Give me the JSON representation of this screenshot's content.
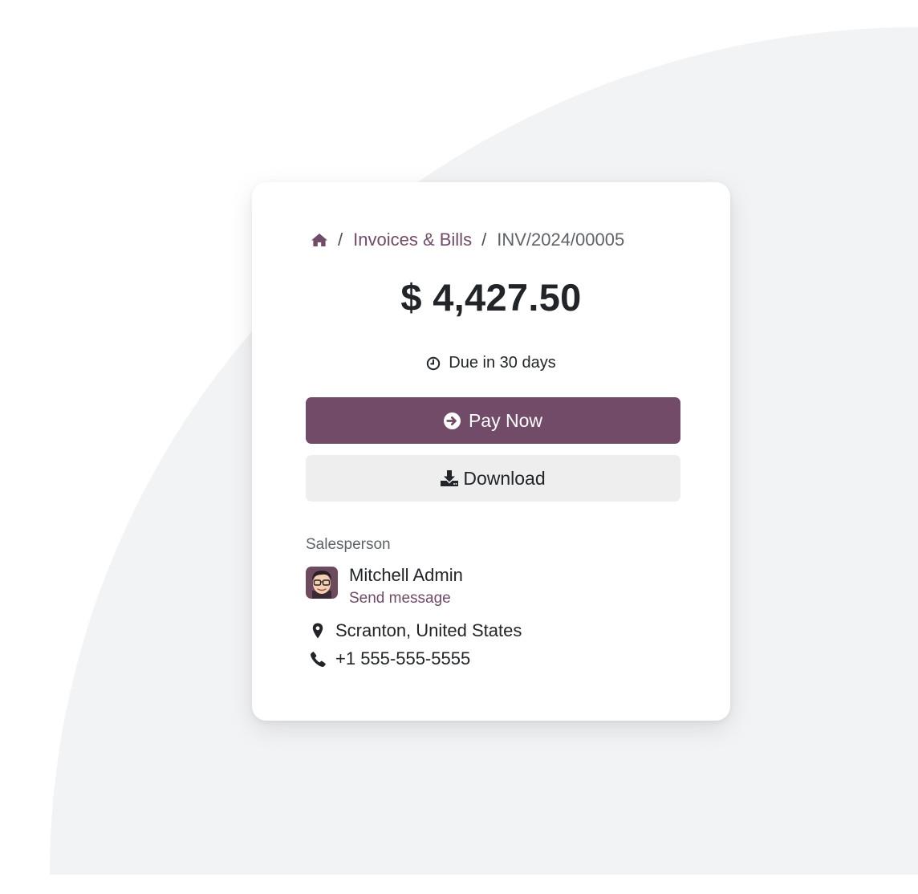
{
  "breadcrumb": {
    "home_icon": "home-icon",
    "separator": "/",
    "parent": "Invoices & Bills",
    "current": "INV/2024/00005"
  },
  "invoice": {
    "amount": "$ 4,427.50",
    "due_icon": "clock-icon",
    "due_text": "Due in 30 days"
  },
  "actions": {
    "pay_icon": "arrow-circle-right-icon",
    "pay_label": "Pay Now",
    "download_icon": "download-icon",
    "download_label": "Download"
  },
  "salesperson": {
    "section_label": "Salesperson",
    "name": "Mitchell Admin",
    "send_message": "Send message",
    "location_icon": "map-marker-icon",
    "location": "Scranton, United States",
    "phone_icon": "phone-icon",
    "phone": "+1 555-555-5555"
  },
  "colors": {
    "brand": "#714b67",
    "background_shape": "#f2f3f5",
    "secondary_button": "#eeeeee",
    "text": "#212529"
  }
}
